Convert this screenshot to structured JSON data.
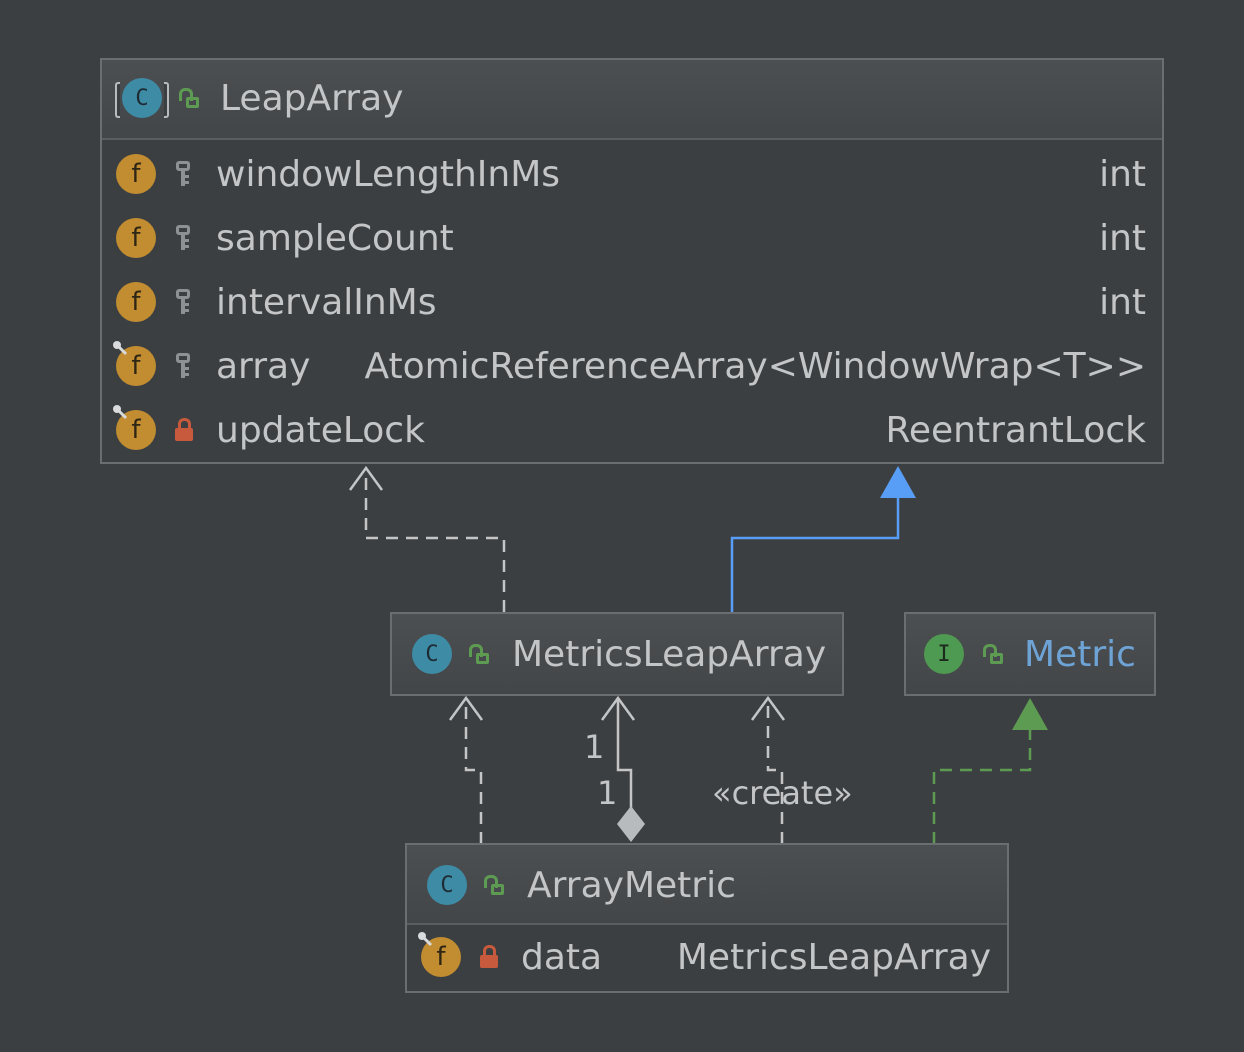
{
  "colors": {
    "background": "#3c3f41",
    "border": "#6b6e70",
    "text": "#c3c5c7",
    "interface_title": "#6ea3d6",
    "generalization_edge": "#589df6",
    "realization_edge": "#5e9b52",
    "dependency_edge": "#c3c5c7",
    "field_icon": "#c28d30",
    "class_icon": "#3e8ba6",
    "interface_icon": "#4f9a52",
    "public_lock": "#5e9b52",
    "private_lock": "#c75a3c"
  },
  "nodes": {
    "leap_array": {
      "title": "LeapArray",
      "kind": "abstract-class",
      "kind_letter": "C",
      "fields": [
        {
          "name": "windowLengthInMs",
          "type": "int",
          "visibility": "package",
          "final": false
        },
        {
          "name": "sampleCount",
          "type": "int",
          "visibility": "package",
          "final": false
        },
        {
          "name": "intervalInMs",
          "type": "int",
          "visibility": "package",
          "final": false
        },
        {
          "name": "array",
          "type": "AtomicReferenceArray<WindowWrap<T>>",
          "visibility": "package",
          "final": true
        },
        {
          "name": "updateLock",
          "type": "ReentrantLock",
          "visibility": "private",
          "final": true
        }
      ]
    },
    "metrics_leap_array": {
      "title": "MetricsLeapArray",
      "kind": "class",
      "kind_letter": "C"
    },
    "metric": {
      "title": "Metric",
      "kind": "interface",
      "kind_letter": "I"
    },
    "array_metric": {
      "title": "ArrayMetric",
      "kind": "class",
      "kind_letter": "C",
      "fields": [
        {
          "name": "data",
          "type": "MetricsLeapArray",
          "visibility": "private",
          "final": true
        }
      ]
    }
  },
  "field_icon_letter": "f",
  "edges": [
    {
      "from": "MetricsLeapArray",
      "to": "LeapArray",
      "type": "dependency"
    },
    {
      "from": "MetricsLeapArray",
      "to": "LeapArray",
      "type": "generalization"
    },
    {
      "from": "ArrayMetric",
      "to": "MetricsLeapArray",
      "type": "dependency"
    },
    {
      "from": "ArrayMetric",
      "to": "MetricsLeapArray",
      "type": "composition",
      "source_multiplicity": "1",
      "target_multiplicity": "1"
    },
    {
      "from": "ArrayMetric",
      "to": "MetricsLeapArray",
      "type": "dependency",
      "stereotype": "«create»"
    },
    {
      "from": "ArrayMetric",
      "to": "Metric",
      "type": "realization"
    }
  ],
  "labels": {
    "composition_target_multiplicity": "1",
    "composition_source_multiplicity": "1",
    "create_stereotype": "«create»"
  }
}
